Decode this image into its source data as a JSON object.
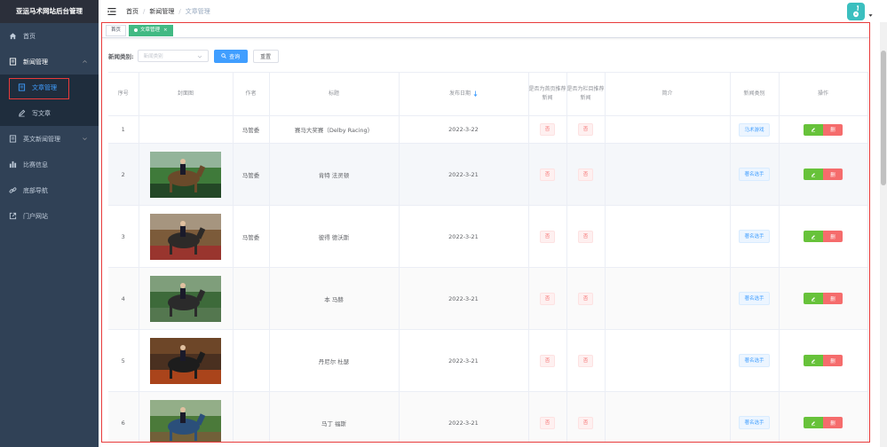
{
  "app_title": "亚运马术网站后台管理",
  "sidebar": {
    "items": [
      {
        "label": "首页"
      },
      {
        "label": "新闻管理"
      },
      {
        "label": "文章管理"
      },
      {
        "label": "写文章"
      },
      {
        "label": "英文新闻管理"
      },
      {
        "label": "比赛信息"
      },
      {
        "label": "底部导航"
      },
      {
        "label": "门户网站"
      }
    ]
  },
  "breadcrumb": [
    "首页",
    "新闻管理",
    "文章管理"
  ],
  "tags": {
    "home": "首页",
    "active": "文章管理",
    "close": "×"
  },
  "search": {
    "label": "新闻类别:",
    "placeholder": "新闻类别",
    "query_label": "查询",
    "reset_label": "重置"
  },
  "table": {
    "headers": {
      "index": "序号",
      "cover": "封面图",
      "author": "作者",
      "title": "标题",
      "date": "发布日期",
      "home_rec": "是否为首页推荐新闻",
      "col_rec": "是否为栏目推荐新闻",
      "intro": "简介",
      "category": "新闻类别",
      "actions": "操作"
    },
    "rows": [
      {
        "index": "1",
        "author": "马管委",
        "title": "赛马大奖赛（Delby Racing）",
        "date": "2022-3-22",
        "home": "否",
        "col": "否",
        "intro": "",
        "category": "马术游戏"
      },
      {
        "index": "2",
        "author": "马管委",
        "title": "肯特 法灵顿",
        "date": "2022-3-21",
        "home": "否",
        "col": "否",
        "intro": "",
        "category": "著名选手"
      },
      {
        "index": "3",
        "author": "马管委",
        "title": "彼得 德沃斯",
        "date": "2022-3-21",
        "home": "否",
        "col": "否",
        "intro": "",
        "category": "著名选手"
      },
      {
        "index": "4",
        "author": "",
        "title": "本 马赫",
        "date": "2022-3-21",
        "home": "否",
        "col": "否",
        "intro": "",
        "category": "著名选手"
      },
      {
        "index": "5",
        "author": "",
        "title": "丹尼尔 杜瑟",
        "date": "2022-3-21",
        "home": "否",
        "col": "否",
        "intro": "",
        "category": "著名选手"
      },
      {
        "index": "6",
        "author": "",
        "title": "马丁 福斯",
        "date": "2022-3-21",
        "home": "否",
        "col": "否",
        "intro": "",
        "category": "著名选手"
      }
    ],
    "delete_label": "删"
  },
  "colors": {
    "sidebar_bg": "#304156",
    "accent": "#409eff",
    "active_tag": "#42b983",
    "danger": "#f56c6c",
    "success": "#67c23a",
    "highlight": "#e83a3a"
  }
}
